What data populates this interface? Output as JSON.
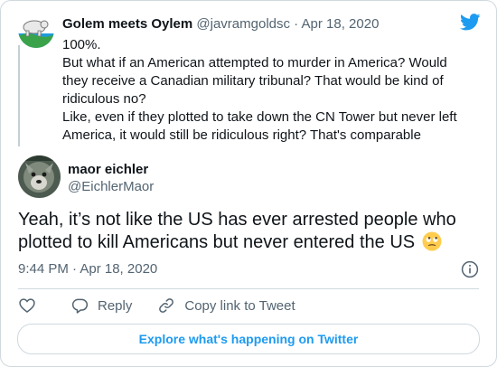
{
  "parent_tweet": {
    "display_name": "Golem meets Oylem",
    "handle": "@javramgoldsc",
    "separator": "·",
    "date": "Apr 18, 2020",
    "paragraphs": [
      "100%.",
      "But what if an American attempted to murder in America? Would they receive a Canadian military tribunal? That would be kind of ridiculous no?",
      "Like, even if they plotted to take down the CN Tower but never left America, it would still be ridiculous right? That's comparable"
    ]
  },
  "tweet": {
    "display_name": "maor eichler",
    "handle": "@EichlerMaor",
    "text": "Yeah, it’s not like the US has ever arrested people who plotted to kill Americans but never entered the US",
    "emoji_icon": "face-with-rolling-eyes-emoji",
    "timestamp": "9:44 PM · Apr 18, 2020"
  },
  "actions": {
    "like_icon": "heart-icon",
    "reply_label": "Reply",
    "copy_label": "Copy link to Tweet"
  },
  "explore_label": "Explore what's happening on Twitter",
  "colors": {
    "accent": "#1d9bf0",
    "text": "#0f1419",
    "muted": "#536471",
    "border": "#cfd9de"
  }
}
